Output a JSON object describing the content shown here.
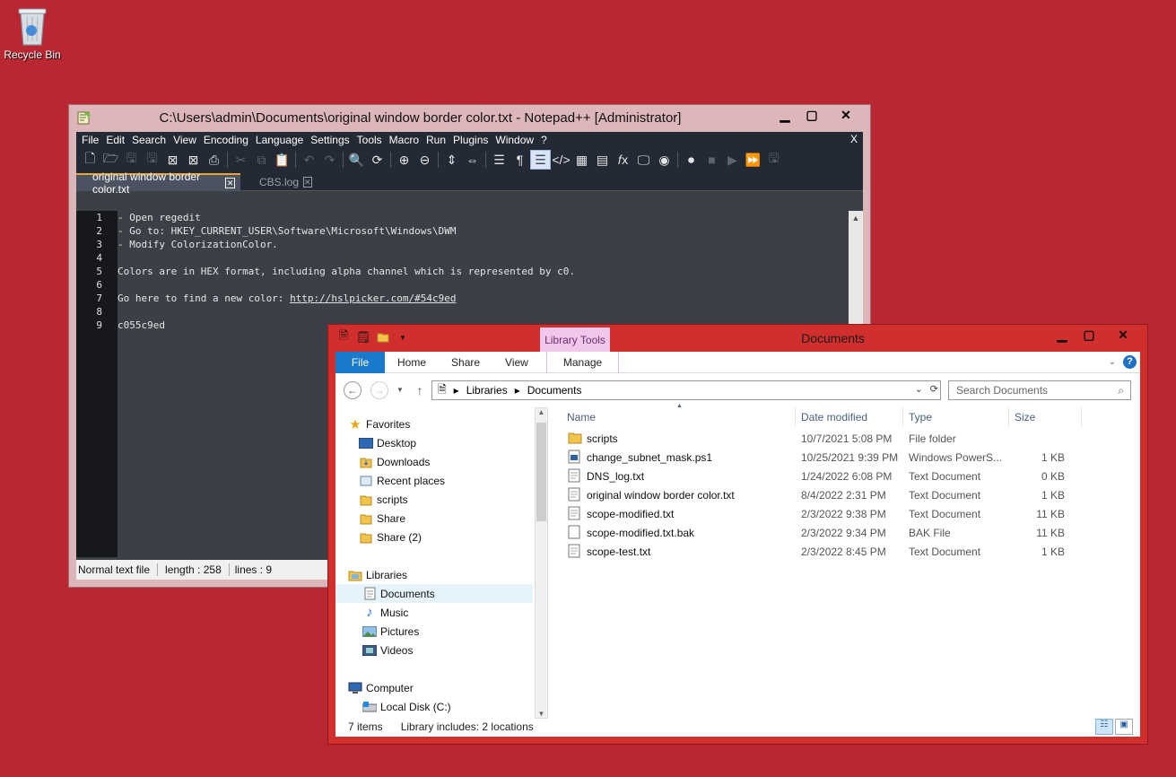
{
  "desktop": {
    "recycle_bin_label": "Recycle Bin"
  },
  "notepad": {
    "title": "C:\\Users\\admin\\Documents\\original window border color.txt - Notepad++ [Administrator]",
    "menu": [
      "File",
      "Edit",
      "Search",
      "View",
      "Encoding",
      "Language",
      "Settings",
      "Tools",
      "Macro",
      "Run",
      "Plugins",
      "Window",
      "?"
    ],
    "menu_close": "X",
    "tabs": [
      {
        "label": "original window border color.txt",
        "active": true
      },
      {
        "label": "CBS.log",
        "active": false
      }
    ],
    "line_numbers": [
      "1",
      "2",
      "3",
      "4",
      "5",
      "6",
      "7",
      "8",
      "9"
    ],
    "lines": [
      "- Open regedit",
      "- Go to: HKEY_CURRENT_USER\\Software\\Microsoft\\Windows\\DWM",
      "- Modify ColorizationColor.",
      "",
      "Colors are in HEX format, including alpha channel which is represented by c0.",
      "",
      "Go here to find a new color: ",
      "",
      "c055c9ed"
    ],
    "link": "http://hslpicker.com/#54c9ed",
    "status": {
      "type": "Normal text file",
      "length": "length : 258",
      "lines": "lines : 9"
    }
  },
  "explorer": {
    "title": "Documents",
    "library_tools": "Library Tools",
    "ribbon_tabs": [
      "File",
      "Home",
      "Share",
      "View",
      "Manage"
    ],
    "address": [
      "Libraries",
      "Documents"
    ],
    "search_placeholder": "Search Documents",
    "nav": {
      "favorites": "Favorites",
      "favorite_items": [
        "Desktop",
        "Downloads",
        "Recent places",
        "scripts",
        "Share",
        "Share (2)"
      ],
      "libraries": "Libraries",
      "library_items": [
        "Documents",
        "Music",
        "Pictures",
        "Videos"
      ],
      "computer": "Computer",
      "computer_items": [
        "Local Disk (C:)"
      ]
    },
    "columns": {
      "name": "Name",
      "date": "Date modified",
      "type": "Type",
      "size": "Size"
    },
    "files": [
      {
        "name": "scripts",
        "date": "10/7/2021 5:08 PM",
        "type": "File folder",
        "size": "",
        "icon": "folder-icon"
      },
      {
        "name": "change_subnet_mask.ps1",
        "date": "10/25/2021 9:39 PM",
        "type": "Windows PowerS...",
        "size": "1 KB",
        "icon": "powershell-file-icon"
      },
      {
        "name": "DNS_log.txt",
        "date": "1/24/2022 6:08 PM",
        "type": "Text Document",
        "size": "0 KB",
        "icon": "text-file-icon"
      },
      {
        "name": "original window border color.txt",
        "date": "8/4/2022 2:31 PM",
        "type": "Text Document",
        "size": "1 KB",
        "icon": "text-file-icon"
      },
      {
        "name": "scope-modified.txt",
        "date": "2/3/2022 9:38 PM",
        "type": "Text Document",
        "size": "11 KB",
        "icon": "text-file-icon"
      },
      {
        "name": "scope-modified.txt.bak",
        "date": "2/3/2022 9:34 PM",
        "type": "BAK File",
        "size": "11 KB",
        "icon": "file-icon"
      },
      {
        "name": "scope-test.txt",
        "date": "2/3/2022 8:45 PM",
        "type": "Text Document",
        "size": "1 KB",
        "icon": "text-file-icon"
      }
    ],
    "status": {
      "items": "7 items",
      "library": "Library includes: 2 locations"
    }
  },
  "colors": {
    "desktop": "#b82732",
    "explorer_frame": "#d12e2e",
    "npp_dark": "#232a35",
    "file_tab": "#1979ca"
  }
}
